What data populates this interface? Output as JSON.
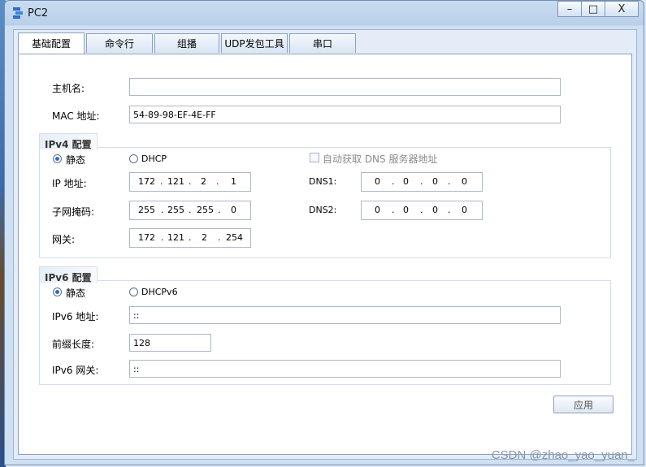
{
  "window": {
    "title": "PC2"
  },
  "titlebar": {
    "minimize": "–",
    "maximize": "□",
    "close": "X"
  },
  "tabs": [
    {
      "label": "基础配置",
      "active": true
    },
    {
      "label": "命令行"
    },
    {
      "label": "组播"
    },
    {
      "label": "UDP发包工具"
    },
    {
      "label": "串口"
    }
  ],
  "basic": {
    "hostname_label": "主机名:",
    "hostname_value": "",
    "mac_label": "MAC 地址:",
    "mac_value": "54-89-98-EF-4E-FF"
  },
  "ipv4": {
    "section_title": "IPv4 配置",
    "static_label": "静态",
    "dhcp_label": "DHCP",
    "auto_dns_label": "自动获取 DNS 服务器地址",
    "ip_label": "IP 地址:",
    "ip": [
      "172",
      "121",
      "2",
      "1"
    ],
    "mask_label": "子网掩码:",
    "mask": [
      "255",
      "255",
      "255",
      "0"
    ],
    "gateway_label": "网关:",
    "gateway": [
      "172",
      "121",
      "2",
      "254"
    ],
    "dns1_label": "DNS1:",
    "dns1": [
      "0",
      "0",
      "0",
      "0"
    ],
    "dns2_label": "DNS2:",
    "dns2": [
      "0",
      "0",
      "0",
      "0"
    ]
  },
  "ipv6": {
    "section_title": "IPv6 配置",
    "static_label": "静态",
    "dhcp_label": "DHCPv6",
    "address_label": "IPv6 地址:",
    "address_value": "::",
    "prefix_label": "前缀长度:",
    "prefix_value": "128",
    "gateway_label": "IPv6 网关:",
    "gateway_value": "::"
  },
  "apply_label": "应用",
  "watermark": "CSDN @zhao_yao_yuan_"
}
